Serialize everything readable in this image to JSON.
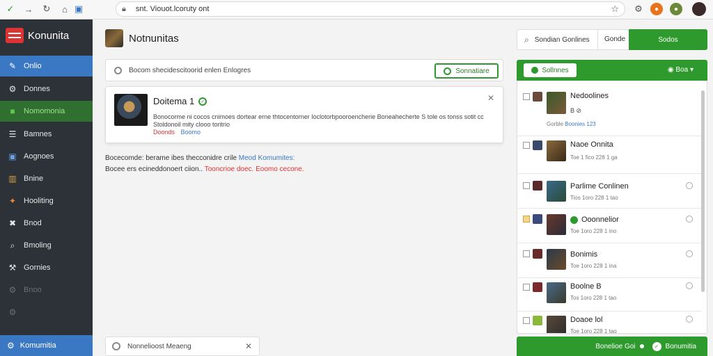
{
  "browser": {
    "url": "snt. Viouot.lcoruty ont"
  },
  "sidebar": {
    "logo": "Konunita",
    "items": [
      {
        "label": "Onlio",
        "icon": "pencil-icon"
      },
      {
        "label": "Donnes",
        "icon": "gear-icon"
      },
      {
        "label": "Nomomonia",
        "icon": "folder-icon"
      },
      {
        "label": "Bamnes",
        "icon": "list-icon"
      },
      {
        "label": "Aognoes",
        "icon": "window-icon"
      },
      {
        "label": "Bnine",
        "icon": "book-icon"
      },
      {
        "label": "Hooliting",
        "icon": "puzzle-icon"
      },
      {
        "label": "Bnod",
        "icon": "tools-icon"
      },
      {
        "label": "Bmoling",
        "icon": "search-icon"
      },
      {
        "label": "Gornies",
        "icon": "wrench-icon"
      },
      {
        "label": "Bnoo",
        "icon": "gear-icon"
      }
    ],
    "bottom_label": "Komumitia"
  },
  "main": {
    "title": "Notnunitas",
    "search_text": "Bocom shecidescitoorid enlen Enlogres",
    "connect_label": "Sonnatiare",
    "card": {
      "title": "Doitema 1",
      "text": "Bonocorme ni cocos cnimoes dortear erne thtocentorner Ioclotorbpooroencherie Boneahecherte S tole os tonss sotit cc Stoldonoil mity clooo toritrio",
      "link_red": "Doonds",
      "link_blue": "Boomo"
    },
    "info1_text": "Bocecomde: berame ibes thecconidre crile",
    "info1_link": "Meod Komumites:",
    "info2_text": "Bocee ers ecineddonoert ciion..",
    "info2_red": "Tooncrioe doec. Eoomo cecone.",
    "toast": "Nonnelioost Meaeng"
  },
  "right": {
    "search_label": "Sondian Gonlines",
    "search_filter": "Gonde",
    "search_button": "Sodos",
    "tab_pill": "Sollnnes",
    "tab_option": "Boa",
    "items": [
      {
        "name": "Nedoolines",
        "sub": "B ⊘",
        "sub2": "Gorble",
        "sub2_hl": "Boonies 123"
      },
      {
        "name": "Naoe Onnita",
        "sub": "Toe 1 fico 228 1 ga"
      },
      {
        "name": "Parlime Conlinen",
        "sub": "Tios 1oro 228 1 tao"
      },
      {
        "name": "Ooonnelior",
        "sub": "Toe 1oro 228 1 ino"
      },
      {
        "name": "Bonimis",
        "sub": "Toe 1oro 228 1 ina"
      },
      {
        "name": "Boolne B",
        "sub": "Tos 1oro 228 1 tao"
      },
      {
        "name": "Doaoe lol",
        "sub": "Toe 1oro 228 1 tao"
      }
    ],
    "footer_left": "Bonelioe Goi",
    "footer_right": "Bonumitia"
  },
  "colors": {
    "sidebar_bg": "#2d3138",
    "accent_blue": "#3a78c4",
    "accent_green": "#2e9a2e",
    "alert_red": "#dd3333"
  }
}
